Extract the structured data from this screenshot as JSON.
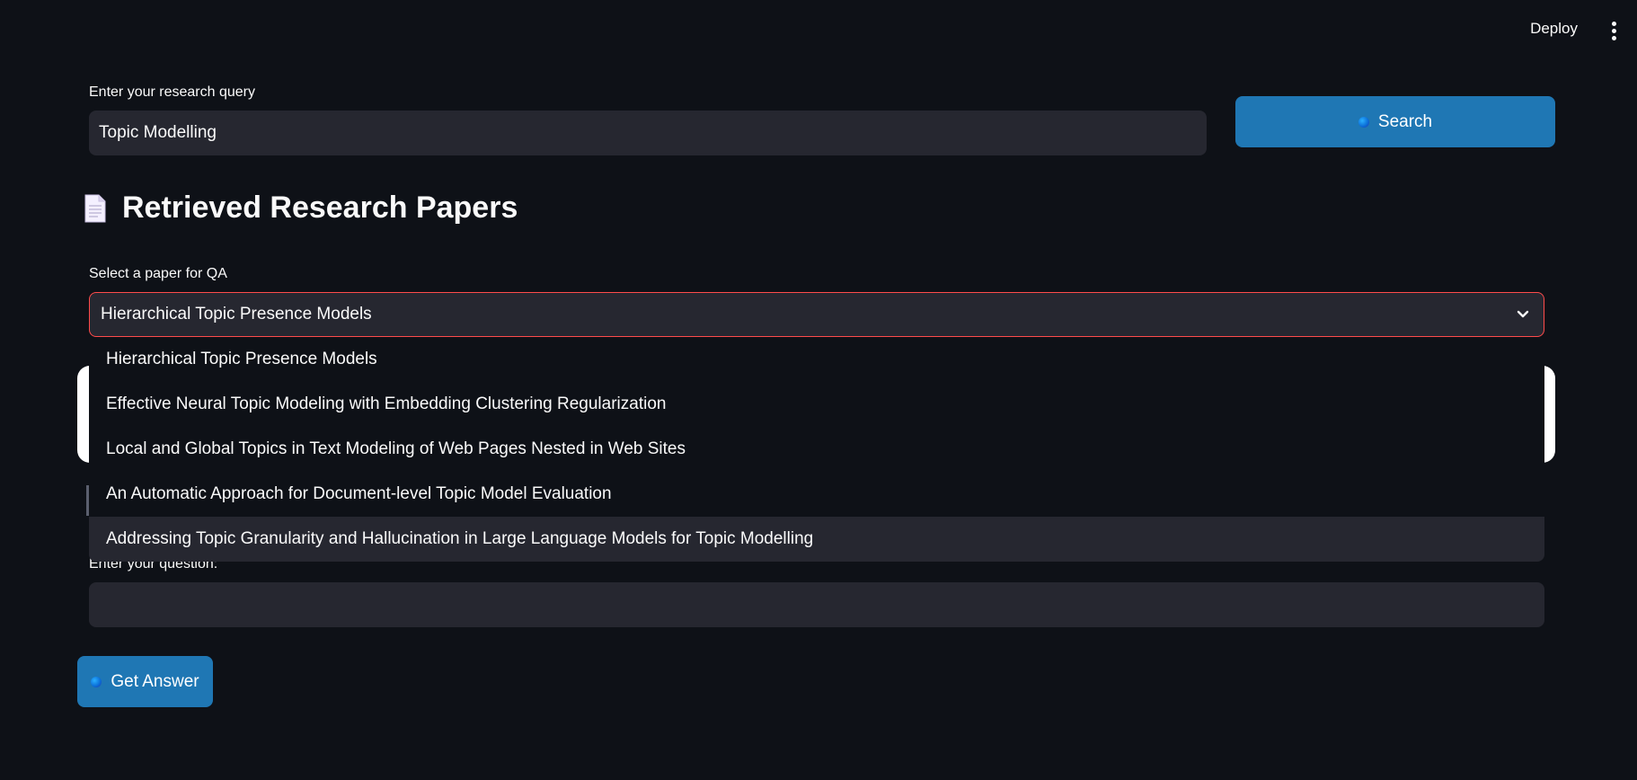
{
  "header": {
    "deploy_label": "Deploy"
  },
  "search": {
    "label": "Enter your research query",
    "value": "Topic Modelling",
    "button_label": "Search"
  },
  "results": {
    "heading": "Retrieved Research Papers",
    "heading_icon": "page-facing-up-icon"
  },
  "paper_select": {
    "label": "Select a paper for QA",
    "selected": "Hierarchical Topic Presence Models",
    "options": [
      "Hierarchical Topic Presence Models",
      "Effective Neural Topic Modeling with Embedding Clustering Regularization",
      "Local and Global Topics in Text Modeling of Web Pages Nested in Web Sites",
      "An Automatic Approach for Document-level Topic Model Evaluation",
      "Addressing Topic Granularity and Hallucination in Large Language Models for Topic Modelling"
    ],
    "hovered_index": 4
  },
  "question": {
    "label": "Enter your question:",
    "value": "",
    "button_label": "Get Answer"
  },
  "colors": {
    "background": "#0e1117",
    "input_bg": "#262730",
    "primary": "#1f77b4",
    "focus_border": "#ff4b4b",
    "text": "#fafafa"
  }
}
